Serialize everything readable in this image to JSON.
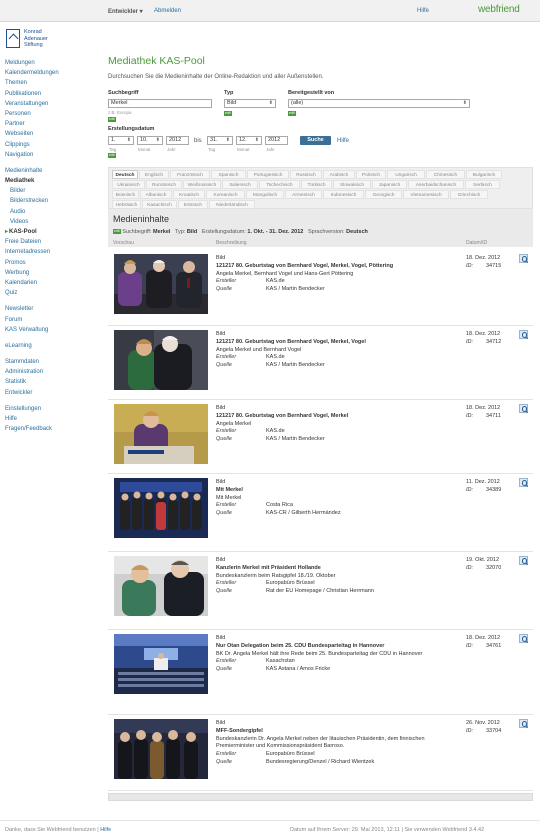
{
  "topbar": {
    "developer": "Entwickler ▾",
    "logout": "Abmelden",
    "help": "Hilfe",
    "brand": "webfriend"
  },
  "logo": {
    "line1": "Konrad",
    "line2": "Adenauer",
    "line3": "Stiftung"
  },
  "sidebar": {
    "items": [
      {
        "label": "Meldungen"
      },
      {
        "label": "Kalendermeldungen"
      },
      {
        "label": "Themen"
      },
      {
        "label": "Publikationen"
      },
      {
        "label": "Veranstaltungen"
      },
      {
        "label": "Personen"
      },
      {
        "label": "Partner"
      },
      {
        "label": "Webseiten"
      },
      {
        "label": "Clippings"
      },
      {
        "label": "Navigation"
      },
      {
        "label": "Medieninhalte"
      },
      {
        "label": "Mediathek"
      },
      {
        "label": "Bilder"
      },
      {
        "label": "Bilderstrecken"
      },
      {
        "label": "Audio"
      },
      {
        "label": "Videos"
      },
      {
        "label": "KAS-Pool"
      },
      {
        "label": "Freie Dateien"
      },
      {
        "label": "Internetadressen"
      },
      {
        "label": "Promos"
      },
      {
        "label": "Werbung"
      },
      {
        "label": "Kalendarien"
      },
      {
        "label": "Quiz"
      },
      {
        "label": "Newsletter"
      },
      {
        "label": "Forum"
      },
      {
        "label": "KAS Verwaltung"
      },
      {
        "label": "eLearning"
      },
      {
        "label": "Stammdaten"
      },
      {
        "label": "Administration"
      },
      {
        "label": "Statistik"
      },
      {
        "label": "Entwickler"
      },
      {
        "label": "Einstellungen"
      },
      {
        "label": "Hilfe"
      },
      {
        "label": "Fragen/Feedback"
      }
    ]
  },
  "page": {
    "title": "Mediathek KAS-Pool",
    "description": "Durchsuchen Sie die Medieninhalte der Online-Redaktion und aller Außenstellen."
  },
  "form": {
    "search_label": "Suchbegriff",
    "search_value": "Merkel",
    "search_hint": "z.B. Europa",
    "type_label": "Typ",
    "type_value": "Bild",
    "provider_label": "Bereitgestellt von",
    "provider_value": "(alle)",
    "date_label": "Erstellungsdatum",
    "from_day": "1.",
    "from_month": "10.",
    "from_year": "2012",
    "bis": "bis",
    "to_day": "31.",
    "to_month": "12.",
    "to_year": "2012",
    "hint_tag": "Tag",
    "hint_monat": "Monat",
    "hint_jahr": "Jahr",
    "edit_tag": "edit",
    "search_button": "Suche",
    "help_link": "Hilfe"
  },
  "languages": [
    "Deutsch",
    "Englisch",
    "Französisch",
    "Spanisch",
    "Portugiesisch",
    "Russisch",
    "Arabisch",
    "Polnisch",
    "Ungarisch",
    "Chinesisch",
    "Bulgarisch",
    "Ukrainisch",
    "Rumänisch",
    "Weißrussisch",
    "Italienisch",
    "Tschechisch",
    "Türkisch",
    "Slowakisch",
    "Japanisch",
    "Aserbaidschanisch",
    "Serbisch",
    "Bosnisch",
    "Albanisch",
    "Kroatisch",
    "Koreanisch",
    "Mongolisch",
    "Armenisch",
    "Indonesisch",
    "Georgisch",
    "Vietnamesisch",
    "Griechisch",
    "Hebräisch",
    "Kasachisch",
    "Estnisch",
    "Niederländisch"
  ],
  "results": {
    "title": "Medieninhalte",
    "edit_tag": "edit",
    "filter_prefix": "Suchbegriff:",
    "filter_term": "Merkel",
    "filter_type_prefix": "Typ:",
    "filter_type": "Bild",
    "filter_date_prefix": "Erstellungsdatum:",
    "filter_date": "1. Okt. - 31. Dez. 2012",
    "filter_lang_prefix": "Sprachversion:",
    "filter_lang": "Deutsch",
    "col_preview": "Vorschau",
    "col_desc": "Beschreibung",
    "col_date": "Datum/ID",
    "label_creator": "Ersteller",
    "label_source": "Quelle",
    "label_id": "ID:",
    "items": [
      {
        "kind": "Bild",
        "title": "121217 80. Geburtstag von Bernhard Vogel, Merkel, Vogel, Pöttering",
        "desc": "Angela Merkel, Bernhard Vogel und Hans-Gert Pöttering",
        "creator": "KAS.de",
        "source": "KAS / Martin Bendecker",
        "date": "18. Dez. 2012",
        "id": "34715"
      },
      {
        "kind": "Bild",
        "title": "121217 80. Geburtstag von Bernhard Vogel, Merkel, Vogel",
        "desc": "Angela Merkel und Bernhard Vogel",
        "creator": "KAS.de",
        "source": "KAS / Martin Bendecker",
        "date": "18. Dez. 2012",
        "id": "34712"
      },
      {
        "kind": "Bild",
        "title": "121217 80. Geburtstag von Bernhard Vogel, Merkel",
        "desc": "Angela Merkel",
        "creator": "KAS.de",
        "source": "KAS / Martin Bendecker",
        "date": "18. Dez. 2012",
        "id": "34711"
      },
      {
        "kind": "Bild",
        "title": "Mit Merkel",
        "desc": "Mit Merkel",
        "creator": "Costa Rica",
        "source": "KAS-CR / Gilberth Hermández",
        "date": "11. Dez. 2012",
        "id": "34389"
      },
      {
        "kind": "Bild",
        "title": "Kanzlerin Merkel mit Präsident Hollande",
        "desc": "Bundeskanzlerin beim Ratsgipfel 18./19. Oktober",
        "creator": "Europabüro Brüssel",
        "source": "Rat der EU Homepage / Christian Herrmann",
        "date": "19. Okt. 2012",
        "id": "32070"
      },
      {
        "kind": "Bild",
        "title": "Nur Otan Delegation beim 25. CDU Bundesparteitag in Hannover",
        "desc": "BK Dr. Angela Merkel hält ihre Rede beim 25. Bundesparteitag der CDU in Hannover",
        "creator": "Kasachstan",
        "source": "KAS Astana / Amos Fricke",
        "date": "18. Dez. 2012",
        "id": "34761"
      },
      {
        "kind": "Bild",
        "title": "MFF-Sondergipfel",
        "desc": "Bundeskanzlerin Dr. Angela Merkel neben der litauischen Präsidentin, dem finnischen Premierminister und Kommissionspräsident Barroso.",
        "creator": "Europabüro Brüssel",
        "source": "Bundesregierung/Denzel / Richard Wientzek",
        "date": "26. Nov. 2012",
        "id": "33704"
      }
    ]
  },
  "footer": {
    "thanks": "Danke, dass Sie Webfriend benutzen |",
    "help": "Hilfe",
    "server": "Datum auf Ihrem Server: 29. Mai 2013, 12:11 | Sie verwenden Webfriend 3.4.42"
  }
}
